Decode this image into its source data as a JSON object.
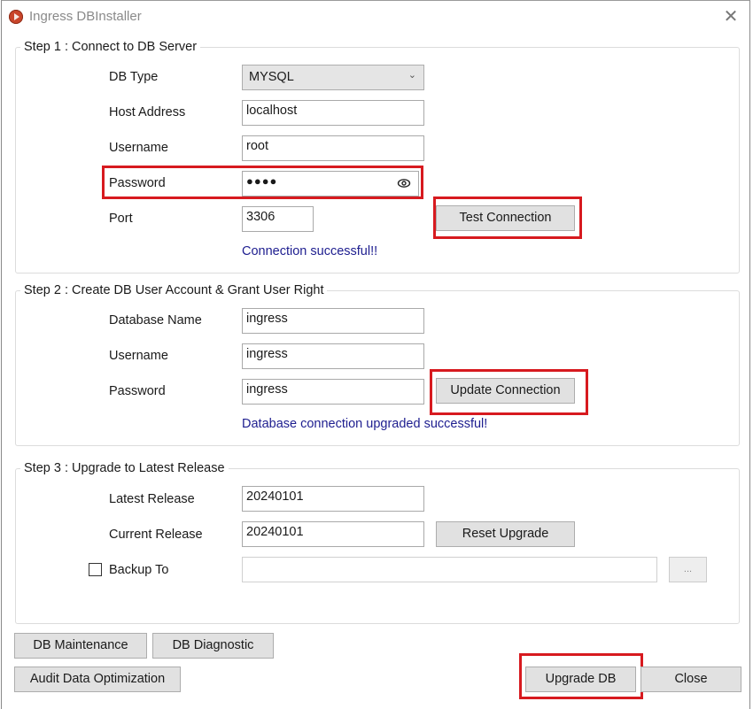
{
  "window": {
    "title": "Ingress DBInstaller",
    "icon": "app-play-icon",
    "close_icon": "close-icon",
    "close_glyph": "✕"
  },
  "step1": {
    "legend": "Step 1 : Connect to DB Server",
    "db_type_label": "DB Type",
    "db_type_value": "MYSQL",
    "db_type_chevron": "⌄",
    "host_label": "Host Address",
    "host_value": "localhost",
    "username_label": "Username",
    "username_value": "root",
    "password_label": "Password",
    "password_value": "●●●●",
    "password_reveal_icon": "eye-icon",
    "port_label": "Port",
    "port_value": "3306",
    "test_button": "Test Connection",
    "status_message": "Connection successful!!"
  },
  "step2": {
    "legend": "Step 2 : Create DB User Account & Grant User Right",
    "dbname_label": "Database Name",
    "dbname_value": "ingress",
    "username_label": "Username",
    "username_value": "ingress",
    "password_label": "Password",
    "password_value": "ingress",
    "update_button": "Update Connection",
    "status_message": "Database connection upgraded successful!"
  },
  "step3": {
    "legend": "Step 3 : Upgrade to Latest Release",
    "latest_label": "Latest Release",
    "latest_value": "20240101",
    "current_label": "Current Release",
    "current_value": "20240101",
    "reset_button": "Reset Upgrade",
    "backup_label": "Backup To",
    "backup_checked": false,
    "backup_path": "",
    "browse_button": "..."
  },
  "footer": {
    "maintenance_button": "DB Maintenance",
    "diagnostic_button": "DB Diagnostic",
    "audit_button": "Audit Data Optimization",
    "upgrade_button": "Upgrade DB",
    "close_button": "Close"
  },
  "colors": {
    "highlight": "#d71a1f",
    "status_text": "#1d1d8f",
    "button_bg": "#e1e1e1",
    "app_icon": "#c9452a"
  }
}
